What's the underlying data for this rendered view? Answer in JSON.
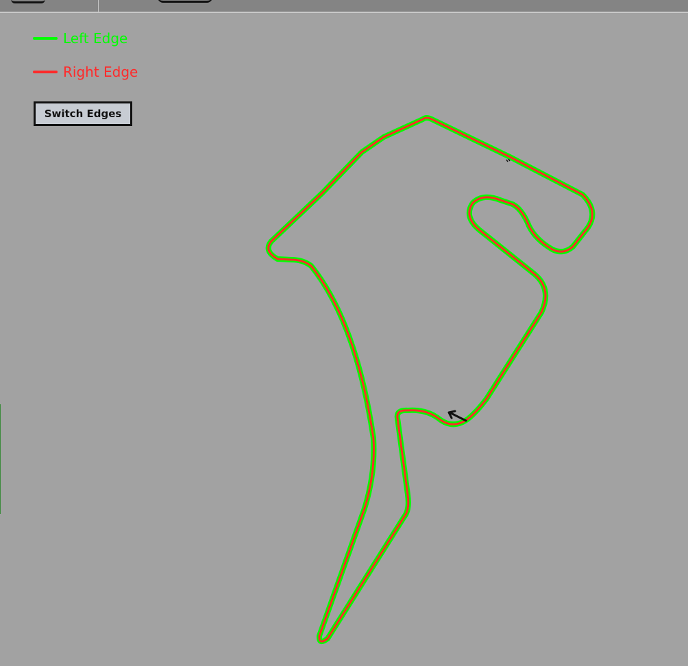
{
  "legend": {
    "left_edge": {
      "label": "Left Edge",
      "color": "#00ff00"
    },
    "right_edge": {
      "label": "Right Edge",
      "color": "#ff2a2a"
    }
  },
  "controls": {
    "switch_edges_label": "Switch Edges"
  },
  "track": {
    "edge_outline_color": "#00ff00",
    "edge_inner_color": "#ff2a2a",
    "direction_arrow_color": "#111111"
  },
  "icons": {
    "direction_arrow": "arrow-up-left-icon"
  }
}
